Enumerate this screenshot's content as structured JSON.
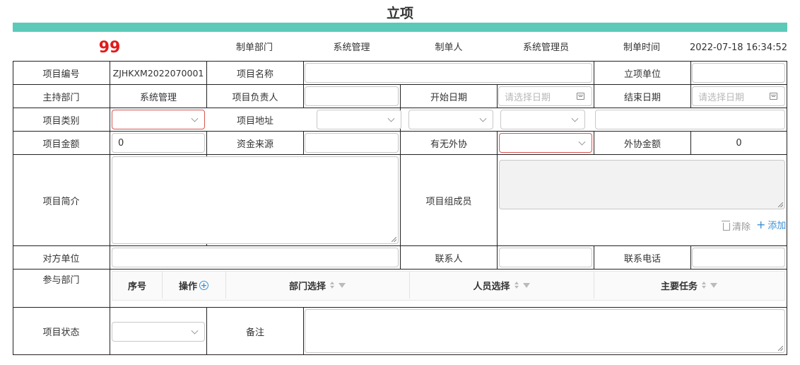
{
  "page": {
    "title": "立项"
  },
  "meta": {
    "number": "99",
    "dept_label": "制单部门",
    "dept_value": "系统管理",
    "creator_label": "制单人",
    "creator_value": "系统管理员",
    "time_label": "制单时间",
    "time_value": "2022-07-18 16:34:52"
  },
  "form": {
    "project_no_label": "项目编号",
    "project_no_value": "ZJHKXM2022070001",
    "project_name_label": "项目名称",
    "project_name_value": "",
    "establish_unit_label": "立项单位",
    "establish_unit_value": "",
    "host_dept_label": "主持部门",
    "host_dept_value": "系统管理",
    "leader_label": "项目负责人",
    "leader_value": "",
    "start_date_label": "开始日期",
    "start_date_placeholder": "请选择日期",
    "end_date_label": "结束日期",
    "end_date_placeholder": "请选择日期",
    "category_label": "项目类别",
    "category_value": "",
    "address_label": "项目地址",
    "address_province": "",
    "address_city": "",
    "address_district": "",
    "address_detail": "",
    "amount_label": "项目金额",
    "amount_value": "0",
    "fund_source_label": "资金来源",
    "fund_source_value": "",
    "outsource_label": "有无外协",
    "outsource_value": "",
    "outsource_amount_label": "外协金额",
    "outsource_amount_value": "0",
    "intro_label": "项目简介",
    "intro_value": "",
    "members_label": "项目组成员",
    "members_value": "",
    "clear_label": "清除",
    "add_label": "添加",
    "counterpart_label": "对方单位",
    "counterpart_value": "",
    "contact_label": "联系人",
    "contact_value": "",
    "phone_label": "联系电话",
    "phone_value": "",
    "participants_label": "参与部门",
    "status_label": "项目状态",
    "status_value": "",
    "remark_label": "备注",
    "remark_value": ""
  },
  "participants_table": {
    "columns": [
      "序号",
      "操作",
      "部门选择",
      "人员选择",
      "主要任务"
    ],
    "rows": []
  }
}
